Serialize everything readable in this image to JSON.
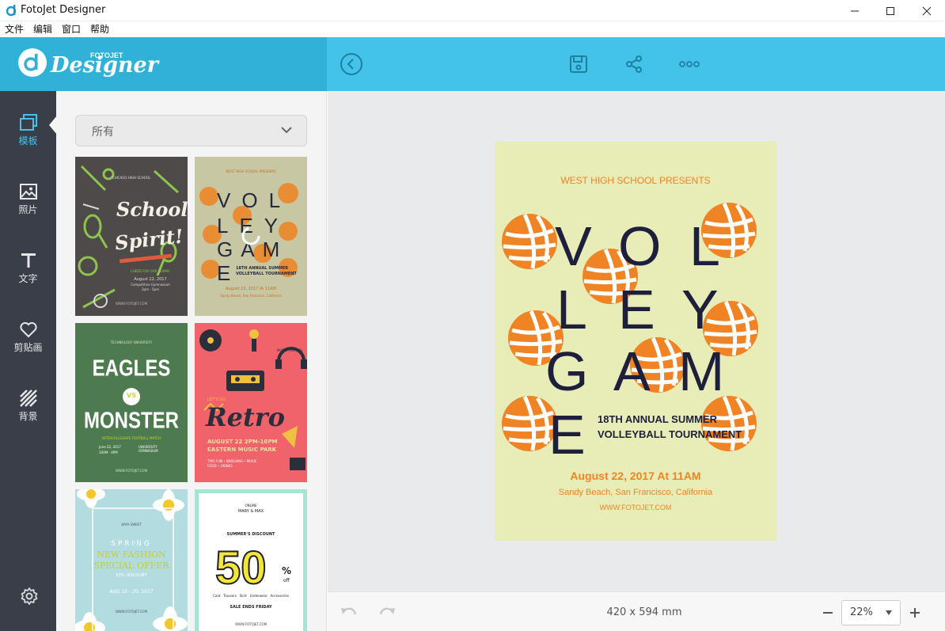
{
  "window": {
    "title": "FotoJet Designer"
  },
  "menu": [
    "文件",
    "编辑",
    "窗口",
    "帮助"
  ],
  "logo": {
    "brand_small": "FOTOJET",
    "brand": "Designer"
  },
  "nav": [
    {
      "label": "模板",
      "icon": "template-icon",
      "active": true
    },
    {
      "label": "照片",
      "icon": "photo-icon"
    },
    {
      "label": "文字",
      "icon": "text-icon"
    },
    {
      "label": "剪贴画",
      "icon": "heart-icon"
    },
    {
      "label": "背景",
      "icon": "background-icon"
    }
  ],
  "panel": {
    "filter_value": "所有"
  },
  "templates": {
    "school_spirit": {
      "top": "CHICAGO HIGH SCHOOL",
      "line1": "School",
      "line2": "Spirit!",
      "cheer": "CHEER FOR OUR TEAMS!",
      "date": "August 22, 2017",
      "venue": "Competitive Gymnasium",
      "time": "2pm - 5pm",
      "site": "WWW.FOTOJET.COM"
    },
    "volley_small": {
      "top": "WEST HIGH SCHOOL PRESENTS",
      "l1": "VOL",
      "l2": "LEY",
      "l3": "GAM",
      "l4": "E",
      "sub1": "18TH ANNUAL SUMMER",
      "sub2": "VOLLEYBALL TOURNAMENT",
      "date": "August 22, 2017 At 11AM",
      "place": "Sandy Beach, San Francisco, California"
    },
    "eagles": {
      "top": "TECHNOLOGY UNIVERSITY",
      "l1": "EAGLES",
      "vs": "VS",
      "l2": "MONSTER",
      "sub": "INTERCOLLEGIATE FOOTBALL MATCH",
      "date": "June 22, 2017",
      "time": "10AM - 4PM",
      "venue": "UNIVERSITY GYMNASIUM",
      "site": "WWW.FOTOJET.COM"
    },
    "retro": {
      "top": "MUSIC FESTIVAL",
      "letsgo": "LET'S GO",
      "title": "Retro",
      "date": "AUGUST 22 2PM-10PM",
      "place": "EASTERN MUSIC PARK",
      "extra1": "TWO FUN • BARGAINS • MUSIC",
      "extra2": "FOOD • DRINKS"
    },
    "spring": {
      "top": "BAYA SWEET",
      "l1": "SPRING",
      "l2": "NEW FASHION",
      "l3": "SPECIAL OFFER",
      "l4": "50% DISCOUNT",
      "date": "AUG 15 - 20, 2017",
      "bottom": "WWW.FOTOJET.COM"
    },
    "discount": {
      "top": "ONLINE",
      "brand": "MARY & MAX",
      "sub": "SUMMER'S DISCOUNT",
      "big": "50",
      "pct": "%",
      "off": "off",
      "cats": "Coat   Trousers   Skirt   Underwear   Accessories",
      "ends": "SALE ENDS FRIDAY",
      "site": "WWW.FOTOJET.COM"
    }
  },
  "poster": {
    "presents": "WEST HIGH SCHOOL PRESENTS",
    "letters": [
      "V",
      "O",
      "L",
      "L",
      "E",
      "Y",
      "G",
      "A",
      "M",
      "E"
    ],
    "sub1": "18TH ANNUAL SUMMER",
    "sub2": "VOLLEYBALL TOURNAMENT",
    "date": "August 22, 2017 At 11AM",
    "place": "Sandy Beach, San Francisco, California",
    "site": "WWW.FOTOJET.COM"
  },
  "bottom": {
    "size": "420 x 594 mm",
    "zoom": "22%"
  },
  "colors": {
    "header": "#43c3e8",
    "logo_bg": "#2fb1d8",
    "sidebar": "#3a3e48",
    "orange": "#f08424",
    "navy": "#1e1f3c",
    "poster_bg": "#e8ecb7"
  }
}
